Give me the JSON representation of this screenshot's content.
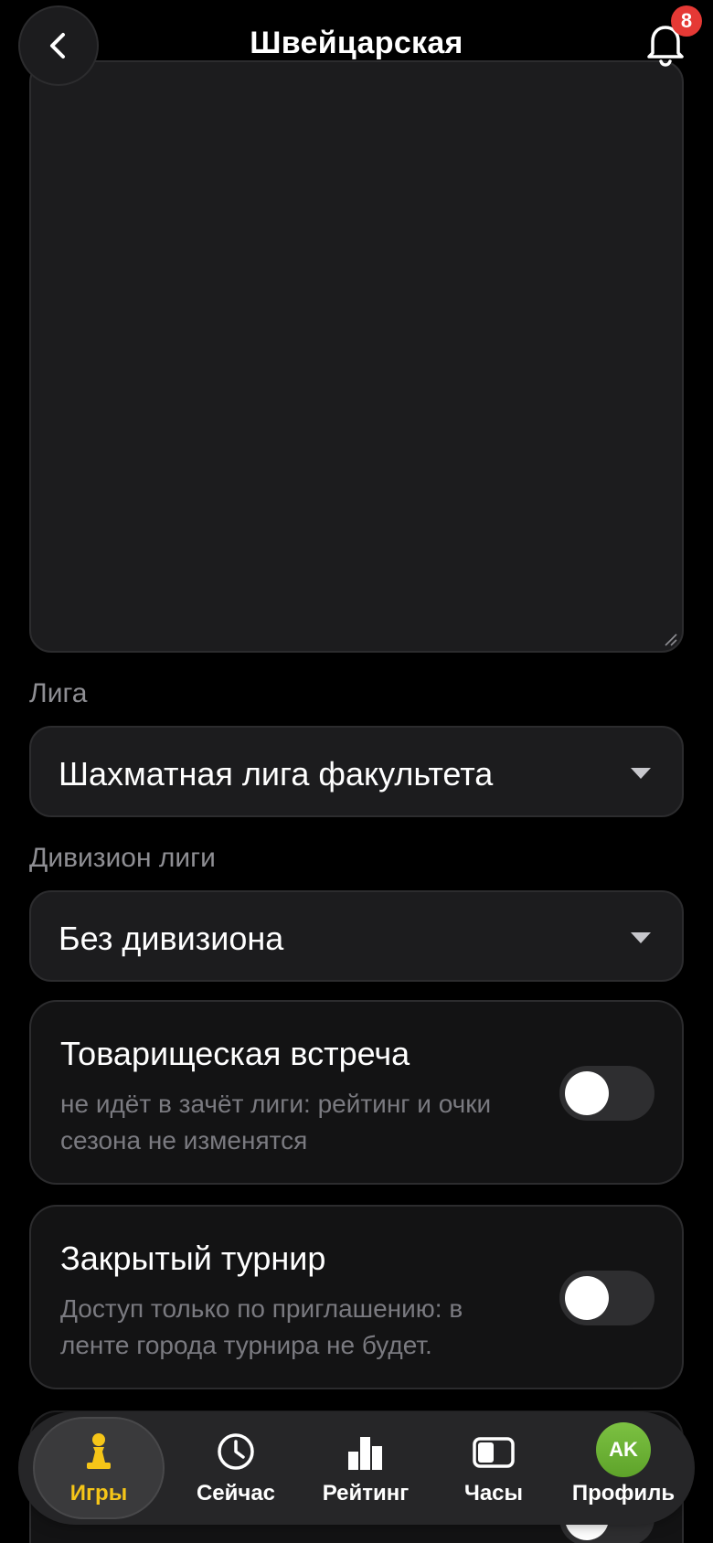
{
  "header": {
    "title": "Швейцарская",
    "notification_count": "8"
  },
  "form": {
    "league_label": "Лига",
    "league_value": "Шахматная лига факультета",
    "division_label": "Дивизион лиги",
    "division_value": "Без дивизиона"
  },
  "cards": [
    {
      "title": "Товарищеская встреча",
      "description": "не идёт в зачёт лиги: рейтинг и очки сезона не изменятся",
      "enabled": false
    },
    {
      "title": "Закрытый турнир",
      "description": "Доступ только по приглашению: в ленте города турнира не будет.",
      "enabled": false
    }
  ],
  "bottom_nav": {
    "items": [
      {
        "label": "Игры",
        "icon": "pawn-icon",
        "active": true
      },
      {
        "label": "Сейчас",
        "icon": "clock-icon",
        "active": false
      },
      {
        "label": "Рейтинг",
        "icon": "bar-chart-icon",
        "active": false
      },
      {
        "label": "Часы",
        "icon": "chess-clock-icon",
        "active": false
      },
      {
        "label": "Профиль",
        "icon": "avatar",
        "active": false
      }
    ],
    "avatar_initials": "AK"
  },
  "colors": {
    "accent": "#f5c518",
    "badge": "#e53935",
    "avatar": "#6cb236"
  }
}
